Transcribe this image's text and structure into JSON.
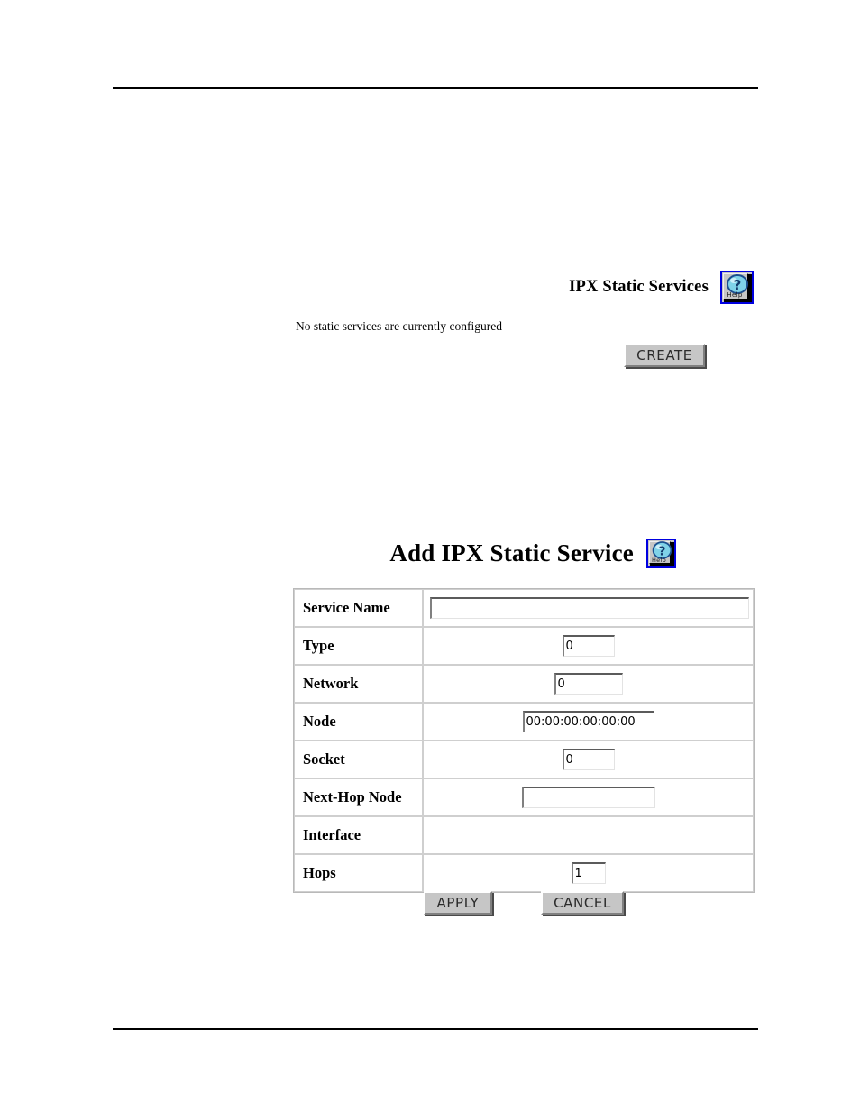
{
  "page": {
    "background": "#ffffff",
    "rules": {
      "color": "#000000"
    }
  },
  "services_section": {
    "heading": "IPX Static Services",
    "help_icon_label": "Help",
    "status_text": "No static services are currently configured",
    "create_label": "CREATE"
  },
  "add_section": {
    "heading": "Add IPX Static Service",
    "help_icon_label": "Help",
    "fields": [
      {
        "label": "Service Name",
        "value": "",
        "input": "servicename"
      },
      {
        "label": "Type",
        "value": "0",
        "input": "type"
      },
      {
        "label": "Network",
        "value": "0",
        "input": "network"
      },
      {
        "label": "Node",
        "value": "00:00:00:00:00:00",
        "input": "node"
      },
      {
        "label": "Socket",
        "value": "0",
        "input": "socket"
      },
      {
        "label": "Next-Hop Node",
        "value": "",
        "input": "nexthop"
      },
      {
        "label": "Interface",
        "value": "",
        "input": "none"
      },
      {
        "label": "Hops",
        "value": "1",
        "input": "hops"
      }
    ],
    "apply_label": "APPLY",
    "cancel_label": "CANCEL"
  },
  "colors": {
    "help_border": "#0000e0",
    "button_face": "#c6c6c6",
    "text": "#000000"
  }
}
